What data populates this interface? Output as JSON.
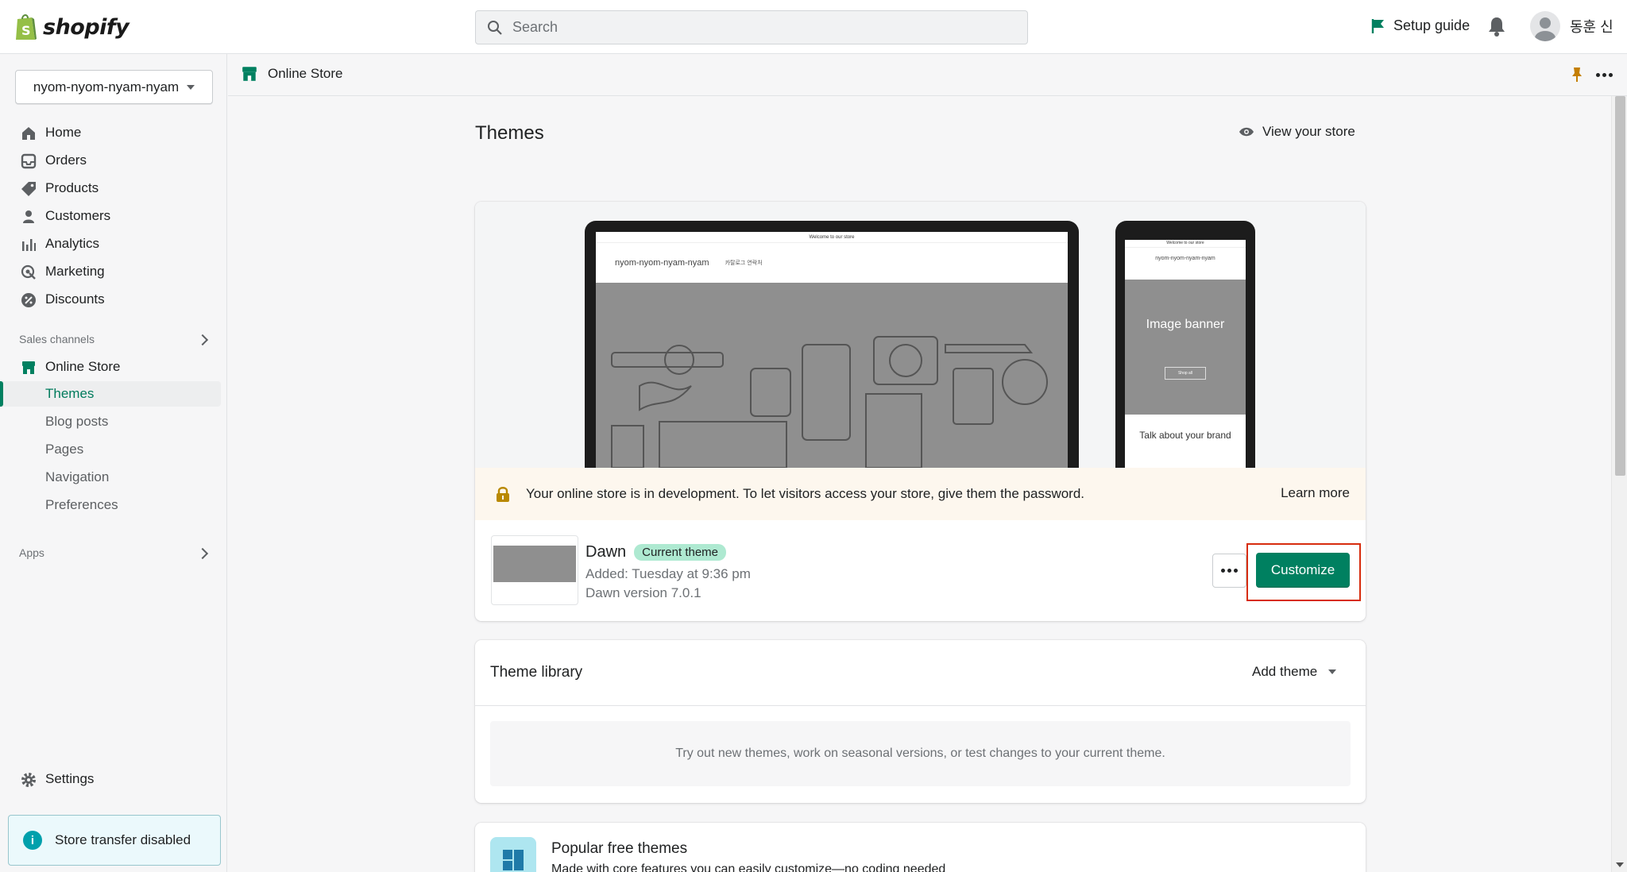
{
  "topbar": {
    "logo_text": "shopify",
    "search_placeholder": "Search",
    "setup_guide": "Setup guide",
    "user_name": "동훈 신"
  },
  "sidebar": {
    "store_name": "nyom-nyom-nyam-nyam",
    "items": [
      {
        "label": "Home",
        "icon": "home-icon"
      },
      {
        "label": "Orders",
        "icon": "orders-icon"
      },
      {
        "label": "Products",
        "icon": "tag-icon"
      },
      {
        "label": "Customers",
        "icon": "person-icon"
      },
      {
        "label": "Analytics",
        "icon": "analytics-icon"
      },
      {
        "label": "Marketing",
        "icon": "marketing-icon"
      },
      {
        "label": "Discounts",
        "icon": "discount-icon"
      }
    ],
    "sales_channels_label": "Sales channels",
    "online_store": "Online Store",
    "sub_items": [
      "Themes",
      "Blog posts",
      "Pages",
      "Navigation",
      "Preferences"
    ],
    "active_sub": "Themes",
    "apps_label": "Apps",
    "settings": "Settings",
    "transfer_notice": "Store transfer disabled"
  },
  "breadcrumb": {
    "label": "Online Store"
  },
  "main": {
    "title": "Themes",
    "view_store": "View your store",
    "preview": {
      "announcement": "Welcome to our store",
      "store_title": "nyom-nyom-nyam-nyam",
      "nav_links": "카탈로그   연락처",
      "phone_announcement": "Welcome to our store",
      "phone_store_title": "nyom-nyom-nyam-nyam",
      "phone_banner": "Image banner",
      "phone_shop": "Shop all",
      "phone_brand": "Talk about your brand"
    },
    "banner": {
      "text": "Your online store is in development. To let visitors access your store, give them the password.",
      "link": "Learn more"
    },
    "current_theme": {
      "name": "Dawn",
      "badge": "Current theme",
      "added": "Added: Tuesday at 9:36 pm",
      "version": "Dawn version 7.0.1",
      "customize": "Customize"
    },
    "library": {
      "title": "Theme library",
      "add_theme": "Add theme",
      "empty_text": "Try out new themes, work on seasonal versions, or test changes to your current theme."
    },
    "popular": {
      "title": "Popular free themes",
      "subtitle": "Made with core features you can easily customize—no coding needed"
    }
  },
  "colors": {
    "accent": "#008060",
    "badge": "#aee9d1",
    "banner_bg": "#fdf7ee",
    "highlight": "#d72c0d"
  }
}
